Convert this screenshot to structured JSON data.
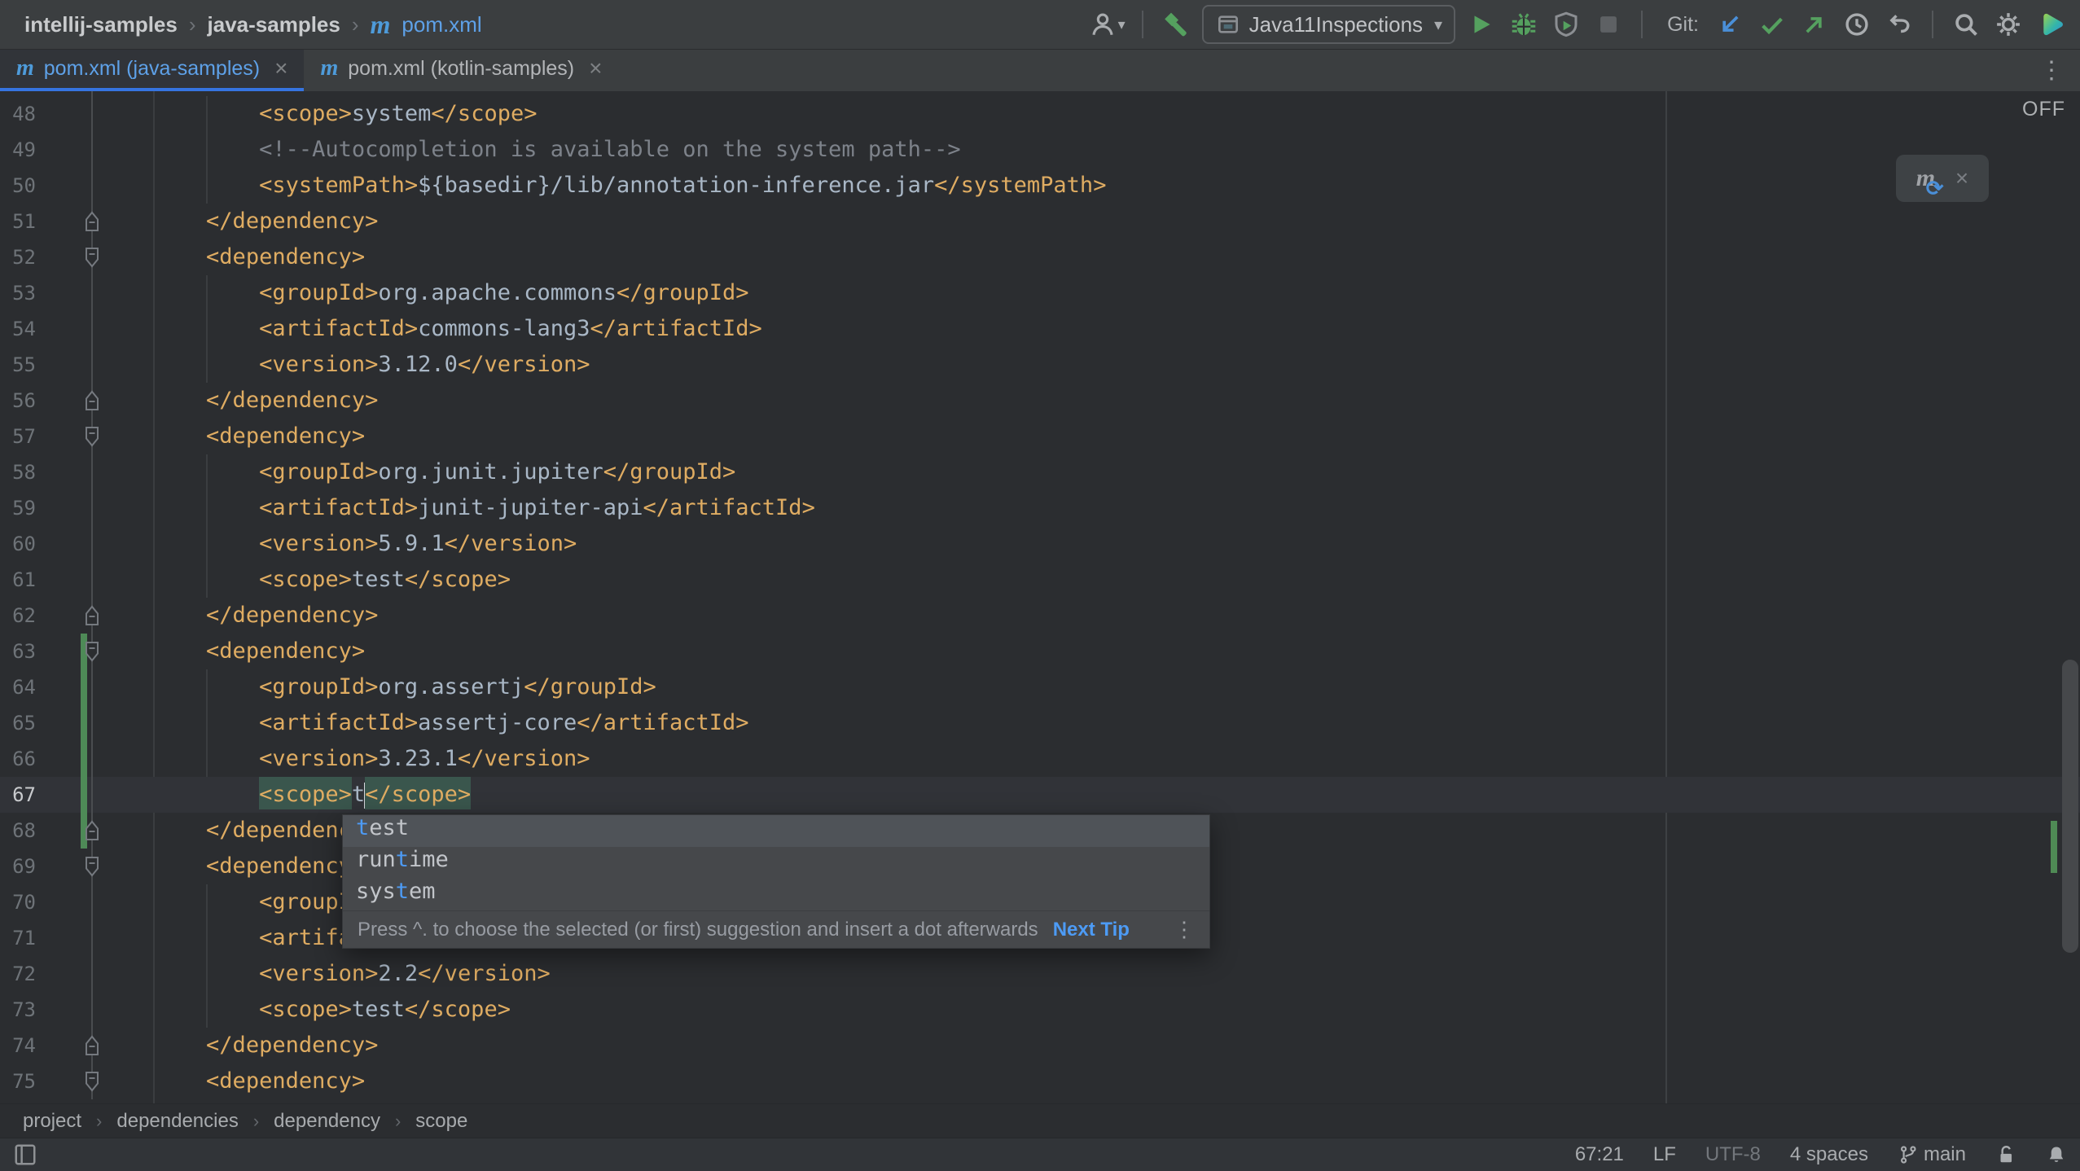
{
  "topbar": {
    "breadcrumbs": [
      "intellij-samples",
      "java-samples",
      "pom.xml"
    ],
    "items": [
      {
        "kind": "user-menu"
      },
      {
        "kind": "divider"
      },
      {
        "kind": "build-hammer"
      },
      {
        "kind": "run-config",
        "label": "Java11Inspections"
      },
      {
        "kind": "run"
      },
      {
        "kind": "debug"
      },
      {
        "kind": "coverage"
      },
      {
        "kind": "stop"
      },
      {
        "kind": "divider"
      },
      {
        "kind": "git-label",
        "label": "Git:"
      },
      {
        "kind": "git-update"
      },
      {
        "kind": "git-commit"
      },
      {
        "kind": "git-push"
      },
      {
        "kind": "history"
      },
      {
        "kind": "rollback"
      },
      {
        "kind": "divider"
      },
      {
        "kind": "search"
      },
      {
        "kind": "settings"
      },
      {
        "kind": "avatar"
      }
    ]
  },
  "tabs": [
    {
      "label": "pom.xml (java-samples)",
      "active": true
    },
    {
      "label": "pom.xml (kotlin-samples)",
      "active": false
    }
  ],
  "editor": {
    "highlighting_badge": "OFF",
    "current_line": 67,
    "fold": {
      "up": [
        51,
        56,
        62,
        68,
        74
      ],
      "down": [
        52,
        57,
        63,
        69,
        75
      ]
    },
    "changed_lines": [
      63,
      68
    ],
    "lines": [
      {
        "n": 48,
        "parts": [
          {
            "c": "txt",
            "t": "            "
          },
          {
            "c": "tag",
            "t": "<scope>"
          },
          {
            "c": "txt",
            "t": "system"
          },
          {
            "c": "tag",
            "t": "</scope>"
          }
        ]
      },
      {
        "n": 49,
        "parts": [
          {
            "c": "txt",
            "t": "            "
          },
          {
            "c": "comment",
            "t": "<!--Autocompletion is available on the system path-->"
          }
        ]
      },
      {
        "n": 50,
        "parts": [
          {
            "c": "txt",
            "t": "            "
          },
          {
            "c": "tag",
            "t": "<systemPath>"
          },
          {
            "c": "txt",
            "t": "${basedir}/lib/annotation-inference.jar"
          },
          {
            "c": "tag",
            "t": "</systemPath>"
          }
        ]
      },
      {
        "n": 51,
        "parts": [
          {
            "c": "txt",
            "t": "        "
          },
          {
            "c": "tag",
            "t": "</dependency>"
          }
        ]
      },
      {
        "n": 52,
        "parts": [
          {
            "c": "txt",
            "t": "        "
          },
          {
            "c": "tag",
            "t": "<dependency>"
          }
        ]
      },
      {
        "n": 53,
        "parts": [
          {
            "c": "txt",
            "t": "            "
          },
          {
            "c": "tag",
            "t": "<groupId>"
          },
          {
            "c": "txt",
            "t": "org.apache.commons"
          },
          {
            "c": "tag",
            "t": "</groupId>"
          }
        ]
      },
      {
        "n": 54,
        "parts": [
          {
            "c": "txt",
            "t": "            "
          },
          {
            "c": "tag",
            "t": "<artifactId>"
          },
          {
            "c": "txt",
            "t": "commons-lang3"
          },
          {
            "c": "tag",
            "t": "</artifactId>"
          }
        ]
      },
      {
        "n": 55,
        "parts": [
          {
            "c": "txt",
            "t": "            "
          },
          {
            "c": "tag",
            "t": "<version>"
          },
          {
            "c": "txt",
            "t": "3.12.0"
          },
          {
            "c": "tag",
            "t": "</version>"
          }
        ]
      },
      {
        "n": 56,
        "parts": [
          {
            "c": "txt",
            "t": "        "
          },
          {
            "c": "tag",
            "t": "</dependency>"
          }
        ]
      },
      {
        "n": 57,
        "parts": [
          {
            "c": "txt",
            "t": "        "
          },
          {
            "c": "tag",
            "t": "<dependency>"
          }
        ]
      },
      {
        "n": 58,
        "parts": [
          {
            "c": "txt",
            "t": "            "
          },
          {
            "c": "tag",
            "t": "<groupId>"
          },
          {
            "c": "txt",
            "t": "org.junit.jupiter"
          },
          {
            "c": "tag",
            "t": "</groupId>"
          }
        ]
      },
      {
        "n": 59,
        "parts": [
          {
            "c": "txt",
            "t": "            "
          },
          {
            "c": "tag",
            "t": "<artifactId>"
          },
          {
            "c": "txt",
            "t": "junit-jupiter-api"
          },
          {
            "c": "tag",
            "t": "</artifactId>"
          }
        ]
      },
      {
        "n": 60,
        "parts": [
          {
            "c": "txt",
            "t": "            "
          },
          {
            "c": "tag",
            "t": "<version>"
          },
          {
            "c": "txt",
            "t": "5.9.1"
          },
          {
            "c": "tag",
            "t": "</version>"
          }
        ]
      },
      {
        "n": 61,
        "parts": [
          {
            "c": "txt",
            "t": "            "
          },
          {
            "c": "tag",
            "t": "<scope>"
          },
          {
            "c": "txt",
            "t": "test"
          },
          {
            "c": "tag",
            "t": "</scope>"
          }
        ]
      },
      {
        "n": 62,
        "parts": [
          {
            "c": "txt",
            "t": "        "
          },
          {
            "c": "tag",
            "t": "</dependency>"
          }
        ]
      },
      {
        "n": 63,
        "parts": [
          {
            "c": "txt",
            "t": "        "
          },
          {
            "c": "tag",
            "t": "<dependency>"
          }
        ]
      },
      {
        "n": 64,
        "parts": [
          {
            "c": "txt",
            "t": "            "
          },
          {
            "c": "tag",
            "t": "<groupId>"
          },
          {
            "c": "txt",
            "t": "org.assertj"
          },
          {
            "c": "tag",
            "t": "</groupId>"
          }
        ]
      },
      {
        "n": 65,
        "parts": [
          {
            "c": "txt",
            "t": "            "
          },
          {
            "c": "tag",
            "t": "<artifactId>"
          },
          {
            "c": "txt",
            "t": "assertj-core"
          },
          {
            "c": "tag",
            "t": "</artifactId>"
          }
        ]
      },
      {
        "n": 66,
        "parts": [
          {
            "c": "txt",
            "t": "            "
          },
          {
            "c": "tag",
            "t": "<version>"
          },
          {
            "c": "txt",
            "t": "3.23.1"
          },
          {
            "c": "tag",
            "t": "</version>"
          }
        ]
      },
      {
        "n": 67,
        "current": true,
        "parts": [
          {
            "c": "txt",
            "t": "            "
          },
          {
            "c": "taghl",
            "t": "<scope>"
          },
          {
            "c": "txt",
            "t": "t"
          },
          {
            "c": "caret",
            "t": ""
          },
          {
            "c": "taghl",
            "t": "</scope>"
          }
        ]
      },
      {
        "n": 68,
        "parts": [
          {
            "c": "txt",
            "t": "        "
          },
          {
            "c": "tag",
            "t": "</dependenc"
          }
        ]
      },
      {
        "n": 69,
        "parts": [
          {
            "c": "txt",
            "t": "        "
          },
          {
            "c": "tag",
            "t": "<dependency"
          }
        ]
      },
      {
        "n": 70,
        "parts": [
          {
            "c": "txt",
            "t": "            "
          },
          {
            "c": "tag",
            "t": "<groupI"
          }
        ]
      },
      {
        "n": 71,
        "parts": [
          {
            "c": "txt",
            "t": "            "
          },
          {
            "c": "tag",
            "t": "<artifa"
          }
        ]
      },
      {
        "n": 72,
        "parts": [
          {
            "c": "txt",
            "t": "            "
          },
          {
            "c": "tag",
            "t": "<version>"
          },
          {
            "c": "txt",
            "t": "2.2"
          },
          {
            "c": "tag",
            "t": "</version>"
          }
        ]
      },
      {
        "n": 73,
        "parts": [
          {
            "c": "txt",
            "t": "            "
          },
          {
            "c": "tag",
            "t": "<scope>"
          },
          {
            "c": "txt",
            "t": "test"
          },
          {
            "c": "tag",
            "t": "</scope>"
          }
        ]
      },
      {
        "n": 74,
        "parts": [
          {
            "c": "txt",
            "t": "        "
          },
          {
            "c": "tag",
            "t": "</dependency>"
          }
        ]
      },
      {
        "n": 75,
        "parts": [
          {
            "c": "txt",
            "t": "        "
          },
          {
            "c": "tag",
            "t": "<dependency>"
          }
        ]
      }
    ]
  },
  "popup": {
    "items": [
      {
        "selected": true,
        "segs": [
          {
            "m": true,
            "t": "t"
          },
          {
            "t": "est"
          }
        ]
      },
      {
        "selected": false,
        "segs": [
          {
            "t": "run"
          },
          {
            "m": true,
            "t": "t"
          },
          {
            "t": "ime"
          }
        ]
      },
      {
        "selected": false,
        "segs": [
          {
            "t": "sys"
          },
          {
            "m": true,
            "t": "t"
          },
          {
            "t": "em"
          }
        ]
      }
    ],
    "hint": "Press ^. to choose the selected (or first) suggestion and insert a dot afterwards",
    "next_tip": "Next Tip"
  },
  "breadcrumbs_bottom": [
    "project",
    "dependencies",
    "dependency",
    "scope"
  ],
  "statusbar": {
    "position": "67:21",
    "line_ending": "LF",
    "encoding": "UTF-8",
    "indent": "4 spaces",
    "branch": "main"
  },
  "colors": {
    "accent_blue": "#3674E0",
    "link_blue": "#4D9BF5",
    "tab_active_text": "#5EA1E8",
    "xml_tag": "#DFAC62",
    "xml_text": "#A9B7C6",
    "comment": "#7D828A",
    "matched_tag_background": "#3A564D",
    "added_line_marker": "#4E8A57",
    "run_green": "#55A15F",
    "git_update_blue": "#4A8FD8",
    "editor_background": "#2B2D30",
    "toolbar_background": "#3B3E40"
  }
}
